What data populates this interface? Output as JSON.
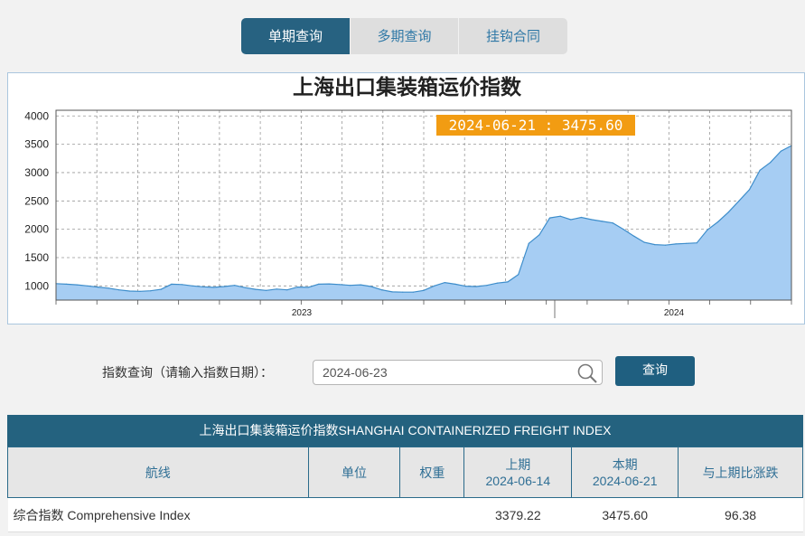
{
  "tabs": [
    {
      "label": "单期查询",
      "active": true
    },
    {
      "label": "多期查询",
      "active": false
    },
    {
      "label": "挂钩合同",
      "active": false
    }
  ],
  "chart_data": {
    "type": "area",
    "title": "上海出口集装箱运价指数",
    "xlabel": "",
    "ylabel": "",
    "ylim": [
      750,
      4100
    ],
    "yticks": [
      1000,
      1500,
      2000,
      2500,
      3000,
      3500,
      4000
    ],
    "x_tick_labels": [
      "2023",
      "2024"
    ],
    "grid": true,
    "colors": {
      "fill": "#a6cdf3",
      "line": "#3d8dcb",
      "tooltip": "#f29c12"
    },
    "series": [
      {
        "values": [
          1040,
          1030,
          1020,
          1000,
          980,
          960,
          930,
          910,
          905,
          915,
          940,
          1030,
          1025,
          1000,
          985,
          975,
          990,
          1010,
          970,
          940,
          920,
          945,
          930,
          980,
          975,
          1030,
          1035,
          1025,
          1010,
          1020,
          990,
          930,
          895,
          890,
          890,
          920,
          1000,
          1060,
          1030,
          995,
          990,
          1010,
          1050,
          1070,
          1200,
          1750,
          1900,
          2200,
          2230,
          2170,
          2210,
          2170,
          2140,
          2110,
          2000,
          1880,
          1770,
          1730,
          1720,
          1740,
          1750,
          1760,
          1990,
          2130,
          2300,
          2500,
          2700,
          3040,
          3180,
          3379.22,
          3475.6
        ]
      }
    ],
    "tooltip": {
      "label": "2024-06-21 : 3475.60"
    }
  },
  "query": {
    "label": "指数查询（请输入指数日期）：",
    "value": "2024-06-23",
    "button": "查询"
  },
  "table": {
    "title": "上海出口集装箱运价指数SHANGHAI CONTAINERIZED FREIGHT INDEX",
    "headers": {
      "route": "航线",
      "unit": "单位",
      "weight": "权重",
      "prev_label": "上期",
      "prev_date": "2024-06-14",
      "curr_label": "本期",
      "curr_date": "2024-06-21",
      "change": "与上期比涨跌"
    },
    "rows": [
      {
        "route": "综合指数 Comprehensive Index",
        "unit": "",
        "weight": "",
        "prev": "3379.22",
        "curr": "3475.60",
        "change": "96.38"
      }
    ]
  }
}
